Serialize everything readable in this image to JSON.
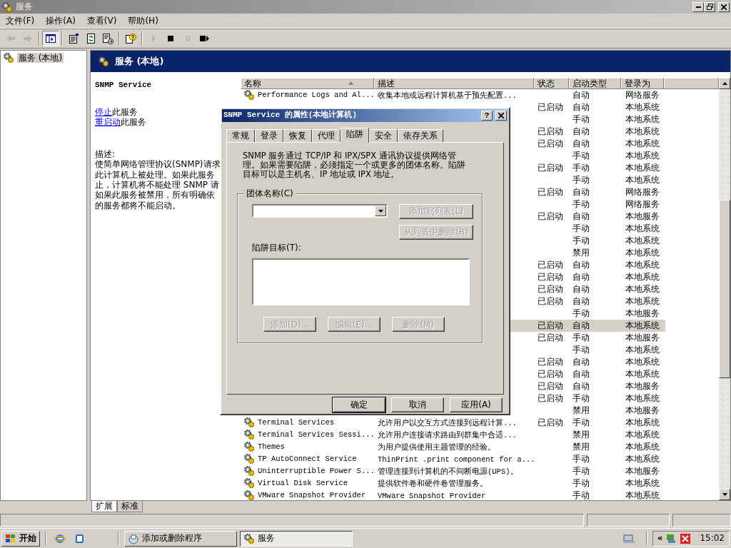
{
  "window": {
    "title": "服务",
    "active": false
  },
  "menu": [
    {
      "label": "文件(F)"
    },
    {
      "label": "操作(A)"
    },
    {
      "label": "查看(V)"
    },
    {
      "label": "帮助(H)"
    }
  ],
  "toolbar": [
    {
      "kind": "back",
      "disabled": true,
      "pressed": false
    },
    {
      "kind": "forward",
      "disabled": true,
      "pressed": false
    },
    {
      "kind": "separator"
    },
    {
      "kind": "tree",
      "disabled": false,
      "pressed": true
    },
    {
      "kind": "separator"
    },
    {
      "kind": "properties",
      "disabled": false,
      "pressed": false
    },
    {
      "kind": "refresh",
      "disabled": false,
      "pressed": false
    },
    {
      "kind": "export",
      "disabled": false,
      "pressed": false
    },
    {
      "kind": "separator"
    },
    {
      "kind": "help",
      "disabled": false,
      "pressed": false
    },
    {
      "kind": "separator"
    },
    {
      "kind": "start",
      "disabled": true,
      "pressed": false
    },
    {
      "kind": "stop",
      "disabled": false,
      "pressed": false
    },
    {
      "kind": "pause",
      "disabled": true,
      "pressed": false
    },
    {
      "kind": "restart",
      "disabled": false,
      "pressed": false
    }
  ],
  "tree": [
    {
      "label": "服务 (本地)",
      "selected": true
    }
  ],
  "pane_header": {
    "title": "服务 (本地)"
  },
  "details": {
    "service_name": "SNMP Service",
    "actions": [
      {
        "link": "停止",
        "text": "此服务"
      },
      {
        "link": "重启动",
        "text": "此服务"
      }
    ],
    "description_label": "描述:",
    "description_lines": [
      "使简单网络管理协议(SNMP)请求",
      "此计算机上被处理。如果此服务",
      "止，计算机将不能处理 SNMP 请",
      "如果此服务被禁用，所有明确依",
      "的服务都将不能启动。"
    ]
  },
  "table": {
    "columns": [
      {
        "label": "名称",
        "sorted": true
      },
      {
        "label": "描述",
        "sorted": false
      },
      {
        "label": "状态",
        "sorted": false
      },
      {
        "label": "启动类型",
        "sorted": false
      },
      {
        "label": "登录为",
        "sorted": false
      }
    ],
    "rows": [
      {
        "name": "Performance Logs and Al...",
        "description": "收集本地或远程计算机基于预先配置...",
        "startup": "自动",
        "logon": "网络服务",
        "selected": false
      },
      {
        "status": "已启动",
        "startup": "自动",
        "logon": "本地系统",
        "selected": false
      },
      {
        "startup": "手动",
        "logon": "本地系统",
        "selected": false
      },
      {
        "status": "已启动",
        "startup": "自动",
        "logon": "本地系统",
        "selected": false
      },
      {
        "status": "已启动",
        "startup": "自动",
        "logon": "本地系统",
        "selected": false
      },
      {
        "startup": "手动",
        "logon": "本地系统",
        "selected": false
      },
      {
        "status": "已启动",
        "startup": "手动",
        "logon": "本地系统",
        "selected": false
      },
      {
        "startup": "手动",
        "logon": "本地系统",
        "selected": false
      },
      {
        "status": "已启动",
        "startup": "自动",
        "logon": "网络服务",
        "selected": false
      },
      {
        "startup": "手动",
        "logon": "网络服务",
        "selected": false
      },
      {
        "status": "已启动",
        "startup": "自动",
        "logon": "本地服务",
        "selected": false
      },
      {
        "startup": "手动",
        "logon": "本地系统",
        "selected": false
      },
      {
        "startup": "手动",
        "logon": "本地系统",
        "selected": false
      },
      {
        "startup": "禁用",
        "logon": "本地系统",
        "selected": false
      },
      {
        "status": "已启动",
        "startup": "自动",
        "logon": "本地系统",
        "selected": false
      },
      {
        "status": "已启动",
        "startup": "自动",
        "logon": "本地系统",
        "selected": false
      },
      {
        "status": "已启动",
        "startup": "自动",
        "logon": "本地系统",
        "selected": false
      },
      {
        "status": "已启动",
        "startup": "自动",
        "logon": "本地系统",
        "selected": false
      },
      {
        "startup": "手动",
        "logon": "本地服务",
        "selected": false
      },
      {
        "status": "已启动",
        "startup": "自动",
        "logon": "本地系统",
        "selected": true
      },
      {
        "status": "已启动",
        "startup": "手动",
        "logon": "本地服务",
        "selected": false
      },
      {
        "startup": "手动",
        "logon": "本地系统",
        "selected": false
      },
      {
        "status": "已启动",
        "startup": "自动",
        "logon": "本地系统",
        "selected": false
      },
      {
        "status": "已启动",
        "startup": "自动",
        "logon": "本地系统",
        "selected": false
      },
      {
        "status": "已启动",
        "startup": "自动",
        "logon": "本地服务",
        "selected": false
      },
      {
        "status": "已启动",
        "startup": "手动",
        "logon": "本地系统",
        "selected": false
      },
      {
        "startup": "禁用",
        "logon": "本地服务",
        "selected": false
      },
      {
        "name": "Terminal Services",
        "description": "允许用户以交互方式连接到远程计算...",
        "status": "已启动",
        "startup": "手动",
        "logon": "本地系统",
        "selected": false
      },
      {
        "name": "Terminal Services Sessi...",
        "description": "允许用户连接请求路由到群集中合适...",
        "startup": "禁用",
        "logon": "本地系统",
        "selected": false
      },
      {
        "name": "Themes",
        "description": "为用户提供使用主题管理的经验。",
        "startup": "禁用",
        "logon": "本地系统",
        "selected": false
      },
      {
        "name": "TP AutoConnect Service",
        "description": "ThinPrint .print component for a...",
        "startup": "手动",
        "logon": "本地系统",
        "selected": false
      },
      {
        "name": "Uninterruptible Power S...",
        "description": "管理连接到计算机的不间断电源(UPS)。",
        "startup": "手动",
        "logon": "本地服务",
        "selected": false
      },
      {
        "name": "Virtual Disk Service",
        "description": "提供软件卷和硬件卷管理服务。",
        "startup": "手动",
        "logon": "本地系统",
        "selected": false
      },
      {
        "name": "VMware Snapshot Provider",
        "description": "VMware Snapshot Provider",
        "startup": "手动",
        "logon": "本地系统",
        "selected": false
      }
    ]
  },
  "view_tabs": [
    {
      "label": "扩展",
      "selected": true
    },
    {
      "label": "标准",
      "selected": false
    }
  ],
  "dialog": {
    "title": "SNMP Service 的属性(本地计算机)",
    "help_button": "?",
    "tabs": [
      {
        "label": "常规",
        "selected": false
      },
      {
        "label": "登录",
        "selected": false
      },
      {
        "label": "恢复",
        "selected": false
      },
      {
        "label": "代理",
        "selected": false
      },
      {
        "label": "陷阱",
        "selected": true
      },
      {
        "label": "安全",
        "selected": false
      },
      {
        "label": "依存关系",
        "selected": false
      }
    ],
    "intro": "SNMP 服务通过 TCP/IP 和 IPX/SPX 通讯协议提供网络管理。如果需要陷阱，必须指定一个或更多的团体名称。陷阱目标可以是主机名、IP 地址或 IPX 地址。",
    "community_label": "团体名称(C)",
    "community_buttons": [
      {
        "label": "添加到列表(L)",
        "disabled": true
      },
      {
        "label": "从列表中删除(R)",
        "disabled": true
      }
    ],
    "targets_label": "陷阱目标(T):",
    "target_buttons": [
      {
        "label": "添加(D)...",
        "disabled": true
      },
      {
        "label": "编辑(E)...",
        "disabled": true
      },
      {
        "label": "删除(M)",
        "disabled": true
      }
    ],
    "footer_buttons": [
      {
        "label": "确定",
        "default": true
      },
      {
        "label": "取消",
        "default": false
      },
      {
        "label": "应用(A)",
        "default": false
      }
    ]
  },
  "taskbar": {
    "start": "开始",
    "tasks": [
      {
        "label": "添加或删除程序",
        "selected": false
      },
      {
        "label": "服务",
        "selected": true
      }
    ],
    "tray_expand": "«",
    "clock": "15:02"
  }
}
